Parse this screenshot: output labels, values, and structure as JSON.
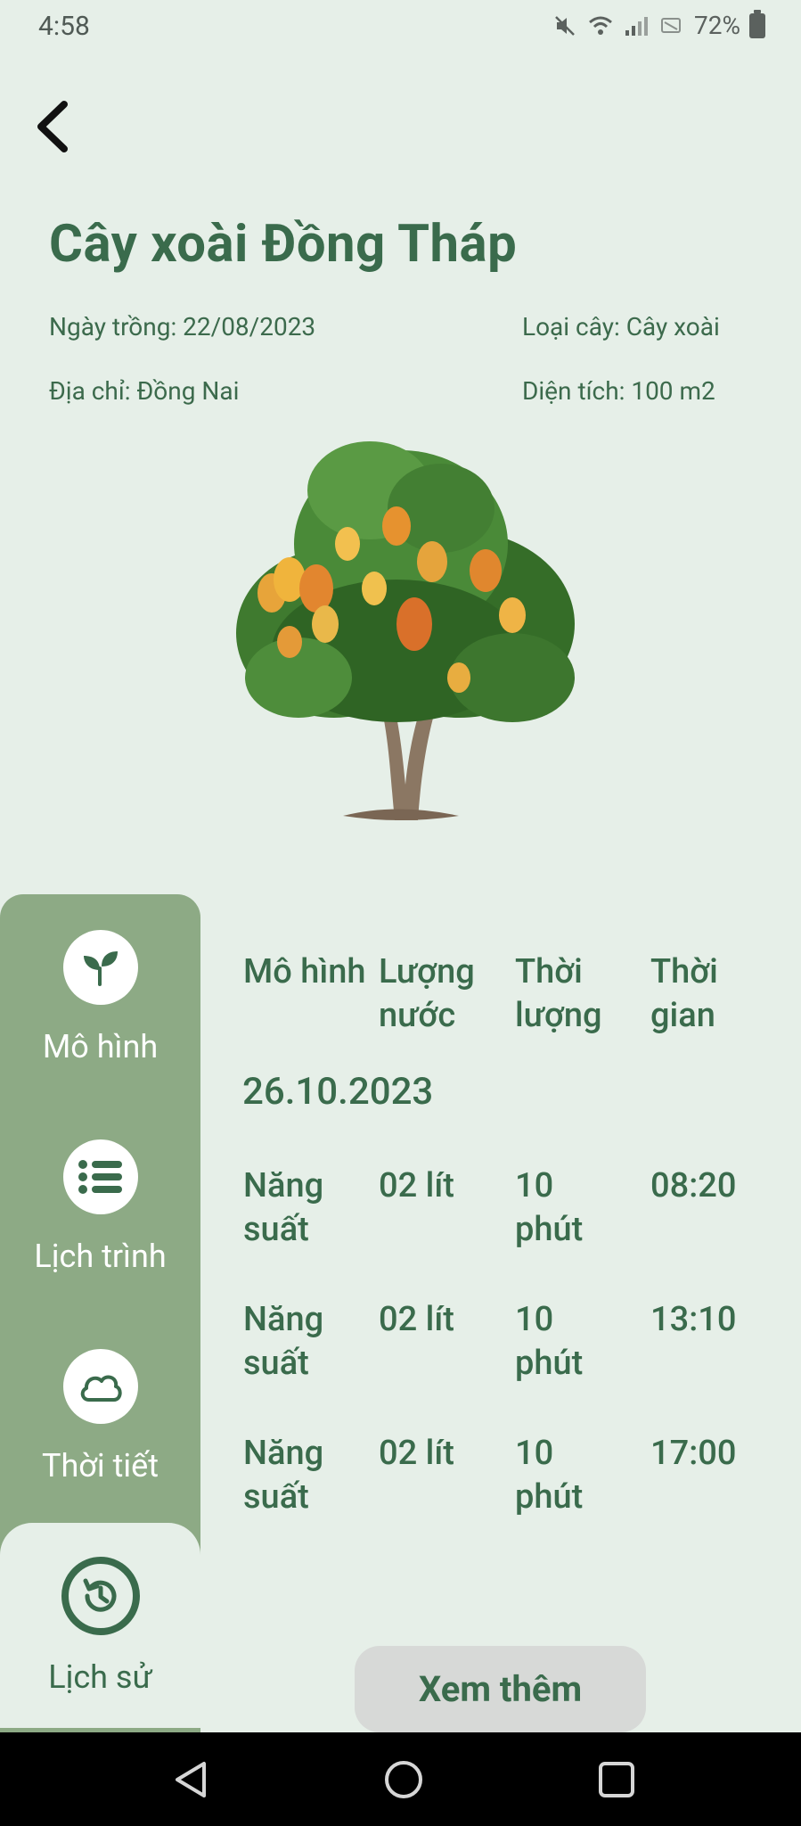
{
  "status_bar": {
    "time": "4:58",
    "battery": "72%"
  },
  "header": {
    "title": "Cây xoài Đồng Tháp",
    "planted_date": "Ngày trồng: 22/08/2023",
    "tree_type": "Loại cây: Cây xoài",
    "address": "Địa chỉ: Đồng Nai",
    "area": "Diện tích: 100 m2"
  },
  "sidebar": {
    "items": [
      {
        "label": "Mô hình",
        "icon": "sprout-icon"
      },
      {
        "label": "Lịch trình",
        "icon": "list-icon"
      },
      {
        "label": "Thời tiết",
        "icon": "cloud-icon"
      },
      {
        "label": "Lịch sử",
        "icon": "history-icon",
        "active": true
      }
    ]
  },
  "table": {
    "headers": [
      "Mô hình",
      "Lượng nước",
      "Thời lượng",
      "Thời gian"
    ],
    "date": "26.10.2023",
    "rows": [
      [
        "Năng suất",
        "02 lít",
        "10 phút",
        "08:20"
      ],
      [
        "Năng suất",
        "02 lít",
        "10 phút",
        "13:10"
      ],
      [
        "Năng suất",
        "02 lít",
        "10 phút",
        "17:00"
      ]
    ]
  },
  "more_button": "Xem thêm",
  "colors": {
    "accent": "#3a6b4c",
    "sidebar": "#8daa85",
    "background": "#e6efe8"
  }
}
